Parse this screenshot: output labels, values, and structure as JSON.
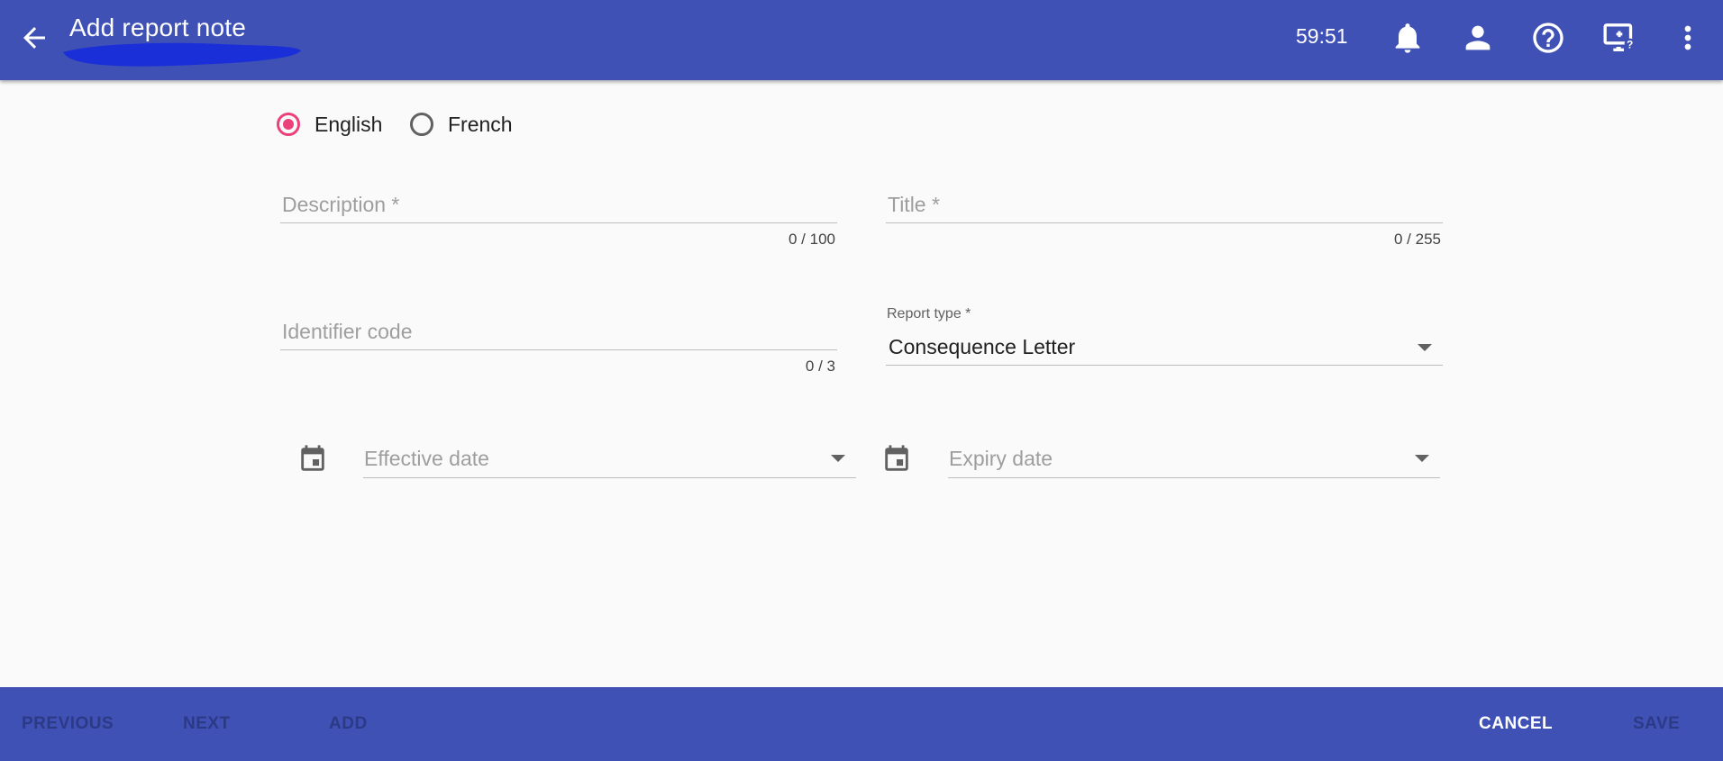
{
  "header": {
    "title": "Add report note",
    "timer": "59:51",
    "icons": [
      "arrow-back-icon",
      "bell-icon",
      "person-icon",
      "help-icon",
      "screen-help-icon",
      "more-vert-icon"
    ]
  },
  "language": {
    "options": [
      {
        "label": "English",
        "checked": true
      },
      {
        "label": "French",
        "checked": false
      }
    ]
  },
  "form": {
    "description": {
      "placeholder": "Description *",
      "counter": "0 / 100"
    },
    "title": {
      "placeholder": "Title *",
      "counter": "0 / 255"
    },
    "identifier": {
      "placeholder": "Identifier code",
      "counter": "0 / 3"
    },
    "report_type": {
      "label": "Report type *",
      "value": "Consequence Letter"
    },
    "effective_date": {
      "placeholder": "Effective date"
    },
    "expiry_date": {
      "placeholder": "Expiry date"
    }
  },
  "footer": {
    "previous": "PREVIOUS",
    "next": "NEXT",
    "add": "ADD",
    "cancel": "CANCEL",
    "save": "SAVE"
  },
  "colors": {
    "primary": "#3f51b5",
    "accent": "#ec407a",
    "background": "#fafafa",
    "redaction": "#1a2fd8"
  }
}
